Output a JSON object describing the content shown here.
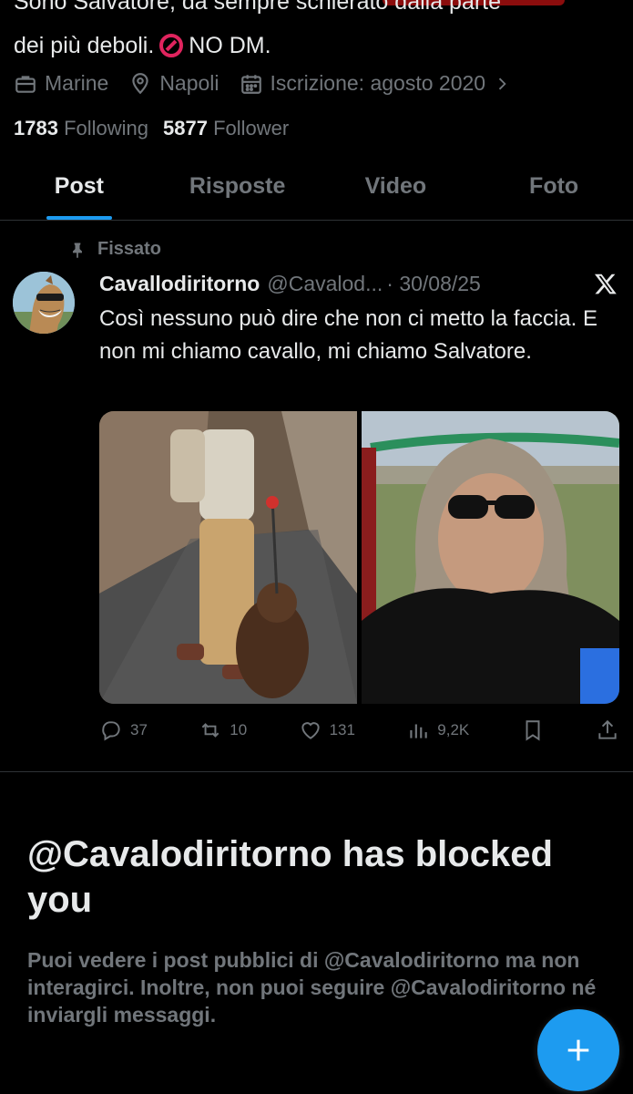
{
  "profile": {
    "bio_line1": "Sono Salvatore, da sempre schierato dalla parte",
    "bio_line2": "dei più deboli.",
    "bio_line2_end": "NO DM.",
    "job": "Marine",
    "location": "Napoli",
    "joined": "Iscrizione: agosto 2020",
    "following_count": "1783",
    "following_label": "Following",
    "follower_count": "5877",
    "follower_label": "Follower"
  },
  "tabs": [
    {
      "label": "Post",
      "active": true
    },
    {
      "label": "Risposte",
      "active": false
    },
    {
      "label": "Video",
      "active": false
    },
    {
      "label": "Foto",
      "active": false
    }
  ],
  "pinned_tweet": {
    "pinned_label": "Fissato",
    "name": "Cavallodiritorno",
    "handle": "@Cavalod...",
    "date": "· 30/08/25",
    "text": "Così nessuno può dire che non ci metto la faccia. E non mi chiamo cavallo, mi chiamo Salvatore.",
    "replies": "37",
    "reposts": "10",
    "likes": "131",
    "views": "9,2K"
  },
  "blocked": {
    "title": "@Cavalodiritorno has blocked you",
    "text": "Puoi vedere i post pubblici di @Cavalodiritorno ma non interagirci. Inoltre, non puoi seguire @Cavalodiritorno né inviargli messaggi."
  },
  "colors": {
    "accent": "#1d9bf0",
    "background": "#000000",
    "text_primary": "#e7e9ea",
    "text_secondary": "#71767b"
  },
  "icons": [
    "briefcase-icon",
    "location-icon",
    "calendar-icon",
    "chevron-right-icon",
    "pin-icon",
    "x-logo-icon",
    "reply-icon",
    "repost-icon",
    "like-icon",
    "views-icon",
    "bookmark-icon",
    "share-icon",
    "compose-plus-icon",
    "no-entry-icon"
  ]
}
